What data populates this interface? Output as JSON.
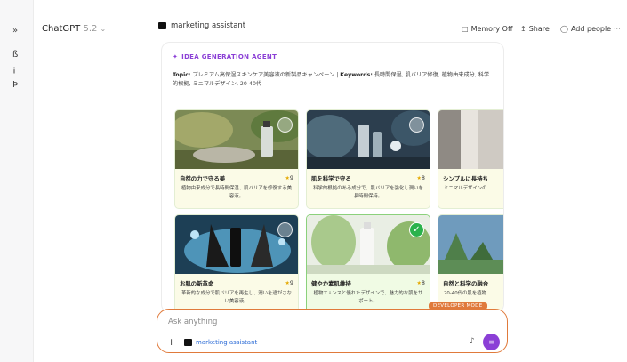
{
  "rail": {
    "icons": [
      "sidebar-toggle-icon",
      "new-chat-icon",
      "search-icon",
      "library-icon"
    ],
    "glyphs": [
      "»",
      "ß",
      "¡",
      "Þ"
    ]
  },
  "header": {
    "model_name": "ChatGPT",
    "model_version": "5.2",
    "project_name": "marketing assistant",
    "memory_label": "Memory Off",
    "share_label": "Share",
    "add_people_label": "Add people",
    "more_glyph": "···"
  },
  "agent": {
    "title": "IDEA GENERATION AGENT",
    "topic_label": "Topic:",
    "topic_value": "プレミアム高保湿スキンケア美容液の新製品キャンペーン",
    "separator": "|",
    "keywords_label": "Keywords:",
    "keywords_value": "長時間保湿, 肌バリア修復, 植物由来成分, 科学的根拠, ミニマルデザイン, 20-40代"
  },
  "ideas": [
    {
      "title": "自然の力で守る美",
      "score": "9",
      "desc": "植物由来成分で長時間保湿、肌バリアを修復する美容液。",
      "selected": false
    },
    {
      "title": "肌を科学で守る",
      "score": "8",
      "desc": "科学的根拠のある成分で、肌バリアを強化し潤いを長時間保持。",
      "selected": false
    },
    {
      "title": "シンプルに長持ち",
      "score": "",
      "desc": "ミニマルデザインの",
      "selected": false
    },
    {
      "title": "お肌の新革命",
      "score": "9",
      "desc": "革新的な成分で肌バリアを再生し、潤いを逃がさない美容液。",
      "selected": false
    },
    {
      "title": "健やか素肌維持",
      "score": "8",
      "desc": "植物エ↓ンスと優れたデザインで、魅力的な肌をサポート。",
      "selected": true
    },
    {
      "title": "自然と科学の融合",
      "score": "",
      "desc": "20-40代の肌を植物",
      "selected": false
    }
  ],
  "star_glyph": "★",
  "check_glyph": "✓",
  "dev_mode_label": "DEVELOPER MODE",
  "composer": {
    "placeholder": "Ask anything",
    "plus_glyph": "+",
    "chip_label": "marketing assistant",
    "mic_glyph": "♪",
    "voice_glyph": "≡"
  },
  "colors": {
    "accent_purple": "#8b3fd6",
    "composer_border": "#e07a3b",
    "selected_green": "#2bb24c",
    "link_blue": "#2b6bd6"
  }
}
